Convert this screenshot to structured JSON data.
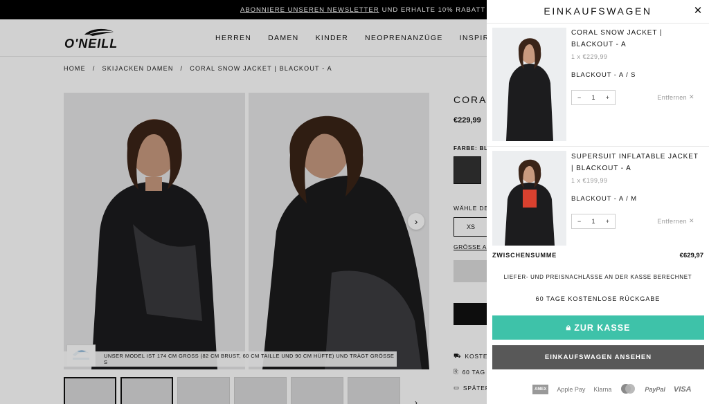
{
  "topbar": {
    "newsletter_link": "ABONNIERE UNSEREN NEWSLETTER",
    "rest": "UND ERHALTE 10% RABATT"
  },
  "header": {
    "nav": [
      "HERREN",
      "DAMEN",
      "KINDER",
      "NEOPRENANZÜGE",
      "INSPIRATION"
    ]
  },
  "breadcrumb": [
    "HOME",
    "/",
    "SKIJACKEN DAMEN",
    "/",
    "CORAL SNOW JACKET | BLACKOUT - A"
  ],
  "product": {
    "name_partial": "CORA",
    "price": "€229,99",
    "farbe_label": "FARBE:",
    "farbe_value": "BLA",
    "waehle_label": "WÄHLE DE",
    "size_xs": "XS",
    "groesse_link": "GRÖSSE AU",
    "perks": [
      "KOSTE",
      "60 TAG",
      "SPÄTER"
    ],
    "model_note": "UNSER MODEL IST 174 CM GROSS (82 CM BRUST, 60 CM TAILLE UND 90 CM HÜFTE) UND TRÄGT GRÖSSE S"
  },
  "cart": {
    "title": "EINKAUFSWAGEN",
    "items": [
      {
        "name": "CORAL SNOW JACKET | BLACKOUT - A",
        "qty_price": "1 x €229,99",
        "variant": "BLACKOUT - A / S",
        "qty": "1",
        "remove": "Entfernen"
      },
      {
        "name": "SUPERSUIT INFLATABLE JACKET | BLACKOUT - A",
        "qty_price": "1 x €199,99",
        "variant": "BLACKOUT - A / M",
        "qty": "1",
        "remove": "Entfernen"
      }
    ],
    "subtotal_label": "ZWISCHENSUMME",
    "subtotal_value": "€629,97",
    "note_shipping": "LIEFER- UND PREISNACHLÄSSE AN DER KASSE BERECHNET",
    "note_returns": "60 TAGE KOSTENLOSE RÜCKGABE",
    "checkout_label": "ZUR KASSE",
    "view_cart_label": "EINKAUFSWAGEN ANSEHEN",
    "payments": [
      "AMEX",
      "Apple Pay",
      "Klarna",
      "Mastercard",
      "PayPal",
      "VISA"
    ]
  },
  "colors": {
    "accent": "#3ec2a9",
    "dark_button": "#585858",
    "topbar": "#000000"
  }
}
